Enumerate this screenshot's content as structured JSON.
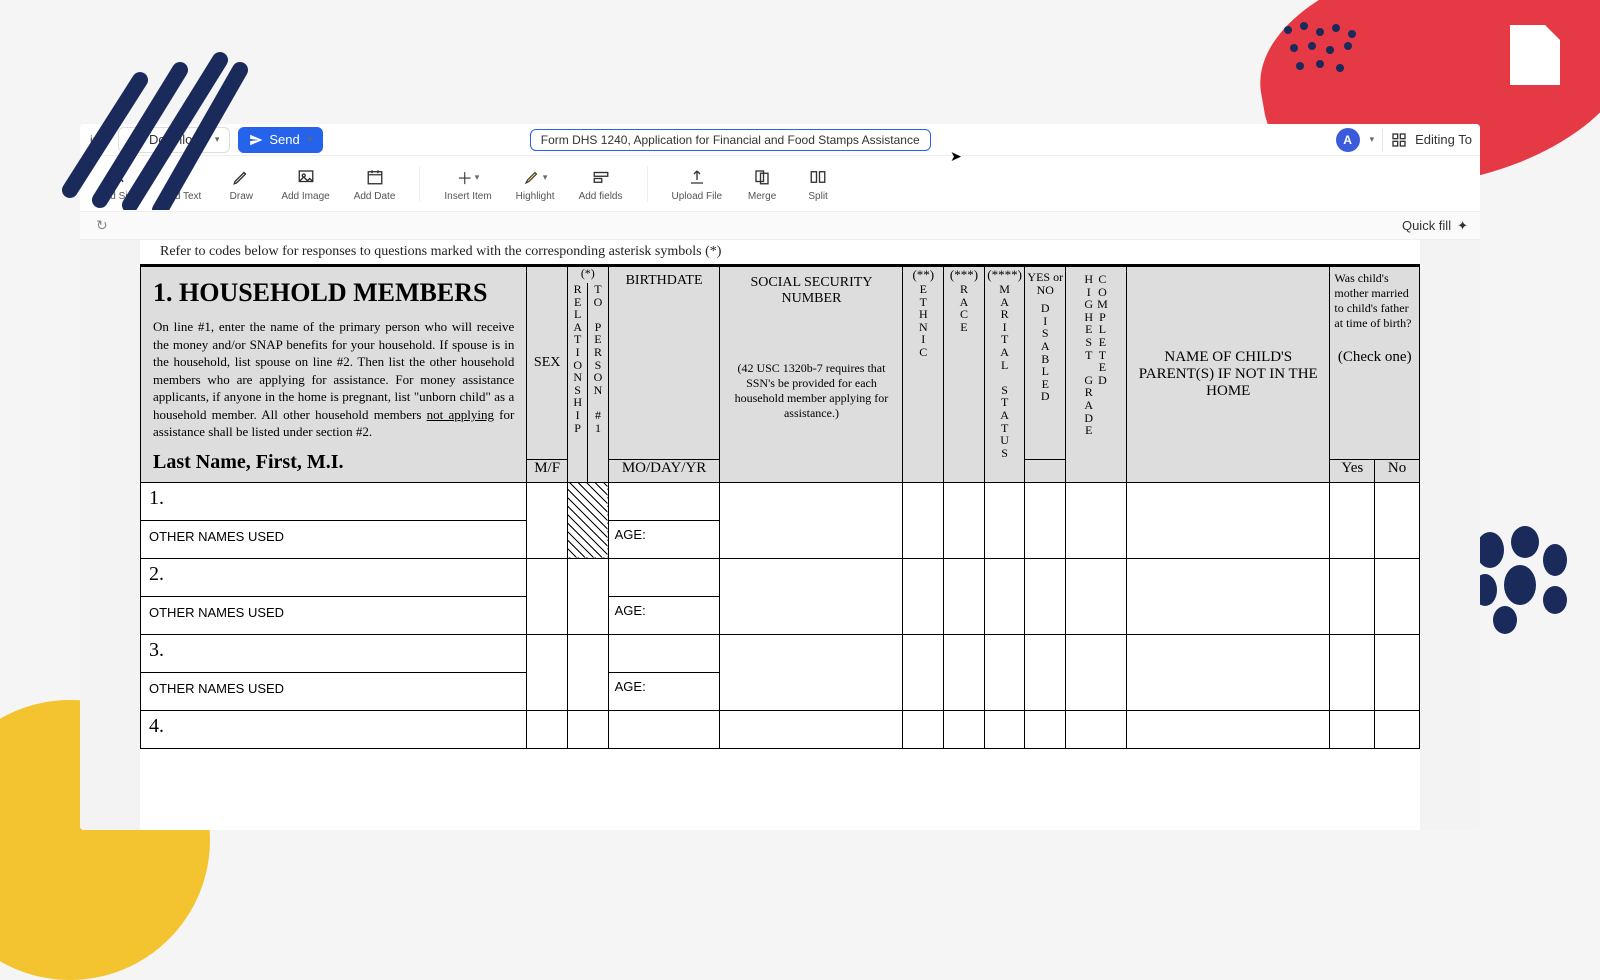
{
  "topbar": {
    "truncated_label": "iner",
    "download": "Download",
    "send": "Send",
    "doc_title": "Form DHS 1240, Application for Financial and Food Stamps Assistance",
    "avatar_initial": "A",
    "editing_label": "Editing To"
  },
  "toolbar": {
    "add_sign": "Add Sign",
    "add_text": "Add Text",
    "draw": "Draw",
    "add_image": "Add Image",
    "add_date": "Add Date",
    "insert_item": "Insert Item",
    "highlight": "Highlight",
    "add_fields": "Add fields",
    "upload_file": "Upload File",
    "merge": "Merge",
    "split": "Split"
  },
  "subbar": {
    "quick_fill": "Quick fill"
  },
  "document": {
    "clipped_header": "Refer to codes below for responses to questions marked with the corresponding asterisk symbols (*)",
    "section_number": "1.",
    "section_title": "HOUSEHOLD MEMBERS",
    "instructions_pre": "On line #1, enter the name of the primary person who will receive the money and/or SNAP benefits for your household. If spouse is in the household, list spouse on line #2. Then list the other household members who are applying for assistance. For money assistance applicants, if anyone in the home is pregnant, list \"unborn child\" as a household member.  All other household members ",
    "instructions_underlined": "not applying",
    "instructions_post": " for assistance shall be listed under section #2.",
    "last_name_label": "Last Name, First, M.I.",
    "columns": {
      "sex": "SEX",
      "mf": "M/F",
      "relationship_star": "(*)",
      "relationship": "RELATIONSHIP",
      "to_person": "TO PERSON #1",
      "birthdate": "BIRTHDATE",
      "modayyr": "MO/DAY/YR",
      "ssn": "SOCIAL SECURITY NUMBER",
      "ssn_note": "(42 USC 1320b-7 requires that SSN's be provided for each household member applying for assistance.)",
      "ethnic_star": "(**)",
      "ethnic": "ETHNIC",
      "race_star": "(***)",
      "race": "RACE",
      "marital_star": "(****)",
      "marital": "MARITAL STATUS",
      "disabled": "DISABLED",
      "yes_or_no": "YES or NO",
      "highest_grade": "HIGHEST GRADE COMPLETED",
      "parent_name": "NAME OF CHILD'S PARENT(S) IF NOT IN THE HOME",
      "married_q": "Was child's mother married to child's father at time of birth?",
      "check_one": "(Check one)",
      "yes": "Yes",
      "no": "No"
    },
    "rows": [
      {
        "num": "1.",
        "other": "OTHER NAMES USED",
        "age": "AGE:"
      },
      {
        "num": "2.",
        "other": "OTHER NAMES USED",
        "age": "AGE:"
      },
      {
        "num": "3.",
        "other": "OTHER NAMES USED",
        "age": "AGE:"
      },
      {
        "num": "4.",
        "other": "",
        "age": ""
      }
    ]
  }
}
